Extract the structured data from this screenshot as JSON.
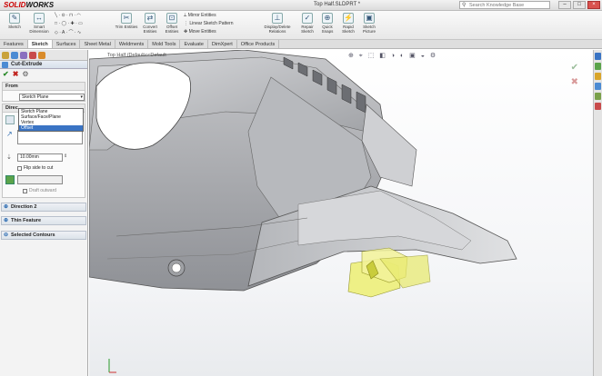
{
  "app": {
    "logo_brand": "SOLID",
    "logo_rest": "WORKS",
    "document_title": "Top Half.SLDPRT *"
  },
  "search": {
    "placeholder": "Search Knowledge Base"
  },
  "toolbar": {
    "sketch": "Sketch",
    "smart_dimension": "Smart Dimension",
    "trim_entities": "Trim Entities",
    "convert_entities": "Convert Entities",
    "offset_entities": "Offset Entities",
    "mirror_entities": "Mirror Entities",
    "linear_sketch_pattern": "Linear Sketch Pattern",
    "move_entities": "Move Entities",
    "display_delete_relations": "Display/Delete Relations",
    "repair_sketch": "Repair Sketch",
    "quick_snaps": "Quick Snaps",
    "rapid_sketch": "Rapid Sketch",
    "sketch_picture": "Sketch Picture"
  },
  "tabs": [
    "Features",
    "Sketch",
    "Surfaces",
    "Sheet Metal",
    "Weldments",
    "Mold Tools",
    "Evaluate",
    "DimXpert",
    "Office Products"
  ],
  "active_tab": "Sketch",
  "property_manager": {
    "title": "Cut-Extrude",
    "from_label": "From",
    "from_value": "Sketch Plane",
    "from_options": [
      "Sketch Plane",
      "Surface/Face/Plane",
      "Vertex",
      "Offset"
    ],
    "highlighted_option": "Offset",
    "direction_label": "Direc",
    "depth_value": "10.00mm",
    "flip_side_label": "Flip side to cut",
    "draft_label": "Draft outward",
    "direction2_label": "Direction 2",
    "thin_feature_label": "Thin Feature",
    "selected_contours_label": "Selected Contours"
  },
  "viewport": {
    "tree_label": "Top Half  (Default<<Default"
  },
  "colors": {
    "ok": "#2a8a2a",
    "cancel": "#c0221e",
    "highlight": "#3a74c4",
    "preview": "#e8e84a"
  }
}
